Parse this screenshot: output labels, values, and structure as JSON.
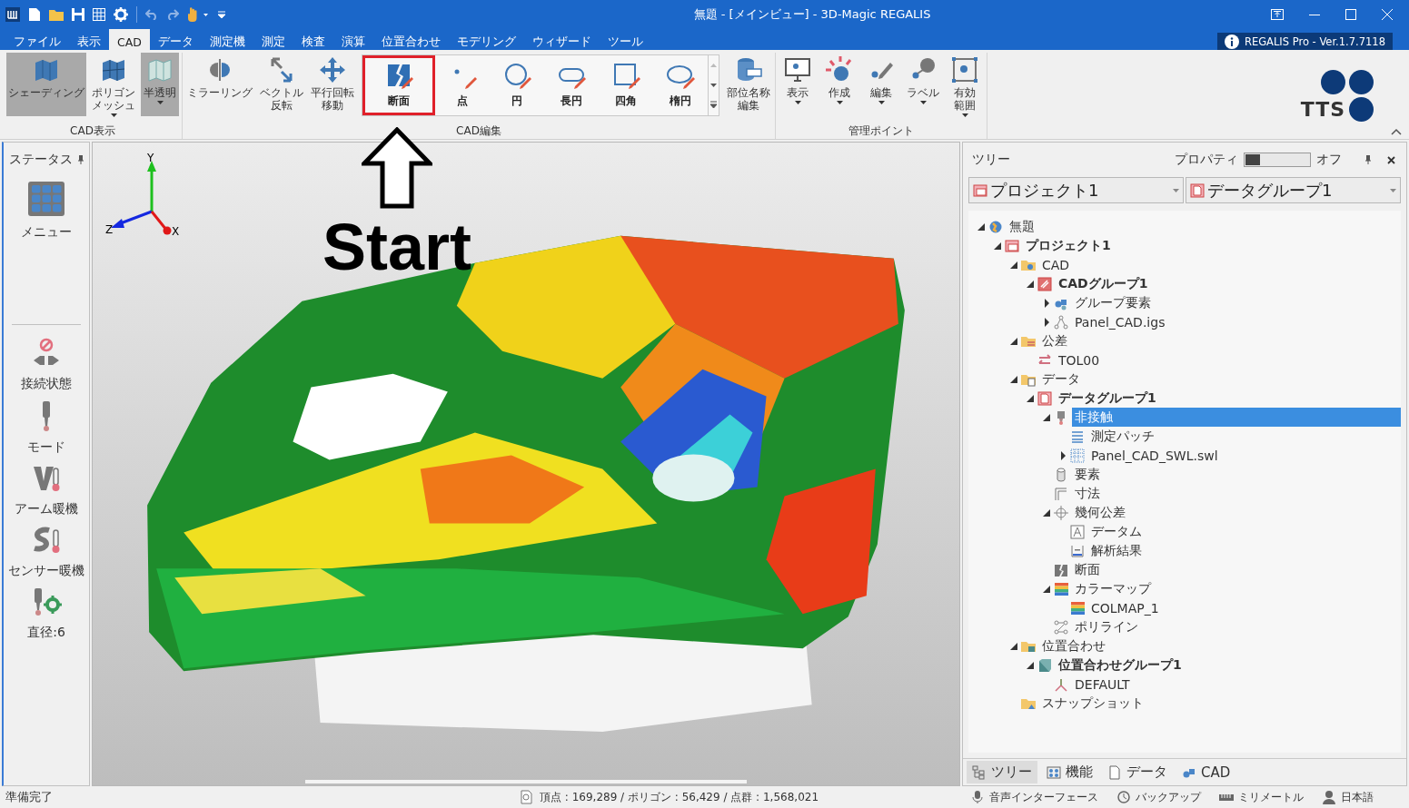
{
  "window": {
    "title": "無題 - [メインビュー] - 3D-Magic REGALIS"
  },
  "menu_tabs": [
    {
      "label": "ファイル",
      "selected": false
    },
    {
      "label": "表示",
      "selected": false
    },
    {
      "label": "CAD",
      "selected": true
    },
    {
      "label": "データ",
      "selected": false
    },
    {
      "label": "測定機",
      "selected": false
    },
    {
      "label": "測定",
      "selected": false
    },
    {
      "label": "検査",
      "selected": false
    },
    {
      "label": "演算",
      "selected": false
    },
    {
      "label": "位置合わせ",
      "selected": false
    },
    {
      "label": "モデリング",
      "selected": false
    },
    {
      "label": "ウィザード",
      "selected": false
    },
    {
      "label": "ツール",
      "selected": false
    }
  ],
  "version_badge": "REGALIS Pro - Ver.1.7.7118",
  "ribbon": [
    {
      "label": "CAD表示",
      "items": [
        {
          "kind": "shading",
          "lines": [
            "シェーディング"
          ],
          "selected": true,
          "dropdown": false
        },
        {
          "kind": "polygon",
          "lines": [
            "ポリゴン",
            "メッシュ"
          ],
          "selected": false,
          "dropdown": true
        },
        {
          "kind": "translucent",
          "lines": [
            "半透明"
          ],
          "selected": true,
          "dropdown": true
        }
      ]
    },
    {
      "label": "CAD編集",
      "items": [
        {
          "kind": "mirror",
          "lines": [
            "ミラーリング"
          ],
          "selected": false,
          "dropdown": false
        },
        {
          "kind": "flip",
          "lines": [
            "ベクトル",
            "反転"
          ],
          "selected": false,
          "dropdown": false
        },
        {
          "kind": "move",
          "lines": [
            "平行回転",
            "移動"
          ],
          "selected": false,
          "dropdown": false
        },
        {
          "kind": "gallery",
          "entries": [
            {
              "kind": "section",
              "label": "断面",
              "highlighted": true
            },
            {
              "kind": "point",
              "label": "点",
              "highlighted": false
            },
            {
              "kind": "circle",
              "label": "円",
              "highlighted": false
            },
            {
              "kind": "slot",
              "label": "長円",
              "highlighted": false
            },
            {
              "kind": "square",
              "label": "四角",
              "highlighted": false
            },
            {
              "kind": "ellipse",
              "label": "楕円",
              "highlighted": false
            }
          ]
        },
        {
          "kind": "partname",
          "lines": [
            "部位名称",
            "編集"
          ],
          "selected": false,
          "dropdown": false
        }
      ]
    },
    {
      "label": "管理ポイント",
      "items": [
        {
          "kind": "mp-show",
          "lines": [
            "表示"
          ],
          "selected": false,
          "dropdown": true
        },
        {
          "kind": "mp-create",
          "lines": [
            "作成"
          ],
          "selected": false,
          "dropdown": true
        },
        {
          "kind": "mp-edit",
          "lines": [
            "編集"
          ],
          "selected": false,
          "dropdown": true
        },
        {
          "kind": "mp-label",
          "lines": [
            "ラベル"
          ],
          "selected": false,
          "dropdown": true
        },
        {
          "kind": "mp-range",
          "lines": [
            "有効",
            "範囲"
          ],
          "selected": false,
          "dropdown": true
        }
      ]
    }
  ],
  "logo_text": "TTS",
  "annotation": {
    "text": "Start"
  },
  "status_panel": {
    "title": "ステータス",
    "items": [
      {
        "kind": "menu",
        "label": "メニュー"
      },
      {
        "kind": "divider"
      },
      {
        "kind": "connection",
        "label": "接続状態"
      },
      {
        "kind": "mode",
        "label": "モード"
      },
      {
        "kind": "arm",
        "label": "アーム暖機"
      },
      {
        "kind": "sensor",
        "label": "センサー暖機"
      },
      {
        "kind": "diameter",
        "label": "直径:6"
      }
    ]
  },
  "viewport": {
    "axes": {
      "x": "X",
      "y": "Y",
      "z": "Z"
    }
  },
  "tree_panel": {
    "title": "ツリー",
    "property_label": "プロパティ",
    "property_switch": {
      "on": false,
      "state_label": "オフ"
    },
    "selectors": [
      {
        "kind": "project",
        "value": "プロジェクト1"
      },
      {
        "kind": "data-group",
        "value": "データグループ1"
      }
    ],
    "tree": [
      {
        "label": "無題",
        "kind": "root",
        "expandable": true,
        "expanded": true,
        "bold": false,
        "selected": false,
        "children": [
          {
            "label": "プロジェクト1",
            "kind": "project",
            "expandable": true,
            "expanded": true,
            "bold": true,
            "selected": false,
            "children": [
              {
                "label": "CAD",
                "kind": "folder-cad",
                "expandable": true,
                "expanded": true,
                "bold": false,
                "selected": false,
                "children": [
                  {
                    "label": "CADグループ1",
                    "kind": "cad-group",
                    "expandable": true,
                    "expanded": true,
                    "bold": true,
                    "selected": false,
                    "children": [
                      {
                        "label": "グループ要素",
                        "kind": "group-elements",
                        "expandable": true,
                        "expanded": false,
                        "bold": false,
                        "selected": false
                      },
                      {
                        "label": "Panel_CAD.igs",
                        "kind": "cad-file",
                        "expandable": true,
                        "expanded": false,
                        "bold": false,
                        "selected": false
                      }
                    ]
                  }
                ]
              },
              {
                "label": "公差",
                "kind": "folder-tol",
                "expandable": true,
                "expanded": true,
                "bold": false,
                "selected": false,
                "children": [
                  {
                    "label": "TOL00",
                    "kind": "tolerance",
                    "expandable": false,
                    "bold": false,
                    "selected": false
                  }
                ]
              },
              {
                "label": "データ",
                "kind": "folder-data",
                "expandable": true,
                "expanded": true,
                "bold": false,
                "selected": false,
                "children": [
                  {
                    "label": "データグループ1",
                    "kind": "data-group",
                    "expandable": true,
                    "expanded": true,
                    "bold": true,
                    "selected": false,
                    "children": [
                      {
                        "label": "非接触",
                        "kind": "probe",
                        "expandable": true,
                        "expanded": true,
                        "bold": false,
                        "selected": true,
                        "children": [
                          {
                            "label": "測定パッチ",
                            "kind": "patch",
                            "expandable": false,
                            "bold": false,
                            "selected": false
                          },
                          {
                            "label": "Panel_CAD_SWL.swl",
                            "kind": "scan",
                            "expandable": true,
                            "expanded": false,
                            "bold": false,
                            "selected": false
                          }
                        ]
                      },
                      {
                        "label": "要素",
                        "kind": "element",
                        "expandable": false,
                        "bold": false,
                        "selected": false
                      },
                      {
                        "label": "寸法",
                        "kind": "dimension",
                        "expandable": false,
                        "bold": false,
                        "selected": false
                      },
                      {
                        "label": "幾何公差",
                        "kind": "gdt",
                        "expandable": true,
                        "expanded": true,
                        "bold": false,
                        "selected": false,
                        "children": [
                          {
                            "label": "データム",
                            "kind": "datum",
                            "expandable": false,
                            "bold": false,
                            "selected": false
                          },
                          {
                            "label": "解析結果",
                            "kind": "result",
                            "expandable": false,
                            "bold": false,
                            "selected": false
                          }
                        ]
                      },
                      {
                        "label": "断面",
                        "kind": "section",
                        "expandable": false,
                        "bold": false,
                        "selected": false
                      },
                      {
                        "label": "カラーマップ",
                        "kind": "colormap",
                        "expandable": true,
                        "expanded": true,
                        "bold": false,
                        "selected": false,
                        "children": [
                          {
                            "label": "COLMAP_1",
                            "kind": "colormap",
                            "expandable": false,
                            "bold": false,
                            "selected": false
                          }
                        ]
                      },
                      {
                        "label": "ポリライン",
                        "kind": "polyline",
                        "expandable": false,
                        "bold": false,
                        "selected": false
                      }
                    ]
                  }
                ]
              },
              {
                "label": "位置合わせ",
                "kind": "folder-align",
                "expandable": true,
                "expanded": true,
                "bold": false,
                "selected": false,
                "children": [
                  {
                    "label": "位置合わせグループ1",
                    "kind": "align-group",
                    "expandable": true,
                    "expanded": true,
                    "bold": true,
                    "selected": false,
                    "children": [
                      {
                        "label": "DEFAULT",
                        "kind": "frame",
                        "expandable": false,
                        "bold": false,
                        "selected": false
                      }
                    ]
                  }
                ]
              },
              {
                "label": "スナップショット",
                "kind": "folder-snap",
                "expandable": false,
                "bold": false,
                "selected": false
              }
            ]
          }
        ]
      }
    ],
    "bottom_tabs": [
      {
        "kind": "tree",
        "label": "ツリー",
        "selected": true
      },
      {
        "kind": "function",
        "label": "機能",
        "selected": false
      },
      {
        "kind": "data",
        "label": "データ",
        "selected": false
      },
      {
        "kind": "cad",
        "label": "CAD",
        "selected": false
      }
    ]
  },
  "status_bar": {
    "message": "準備完了",
    "counts": "頂点 : 169,289 / ポリゴン : 56,429 / 点群 : 1,568,021",
    "items": [
      {
        "kind": "voice",
        "label": "音声インターフェース"
      },
      {
        "kind": "backup",
        "label": "バックアップ"
      },
      {
        "kind": "unit",
        "label": "ミリメートル"
      },
      {
        "kind": "language",
        "label": "日本語"
      }
    ]
  }
}
